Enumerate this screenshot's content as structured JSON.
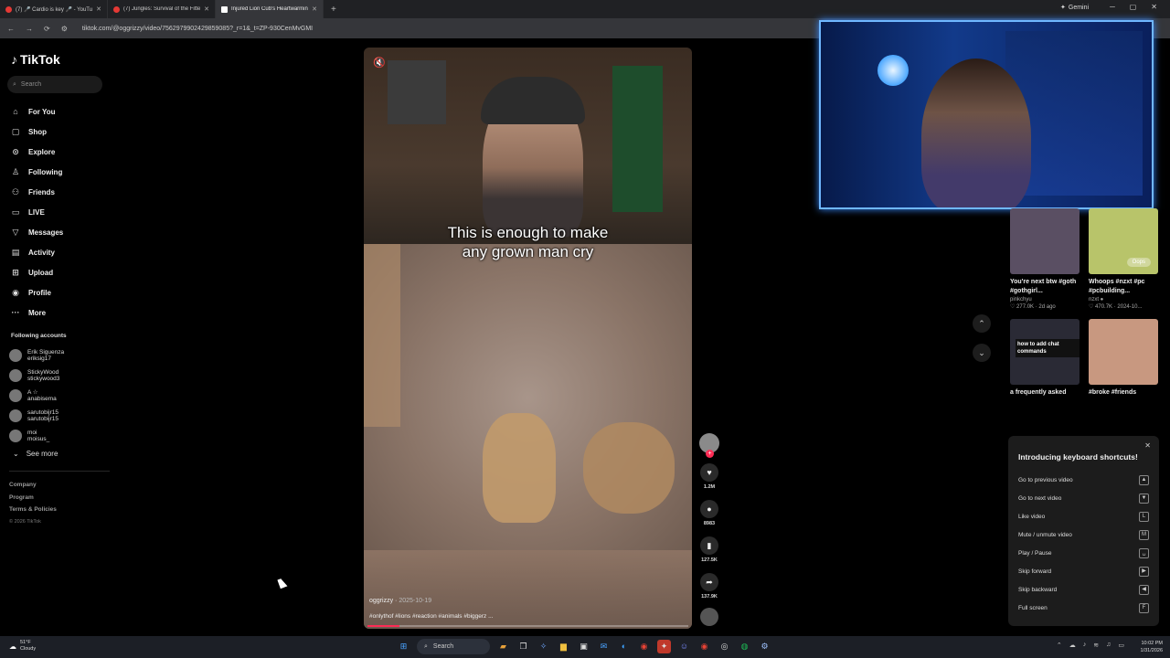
{
  "browser": {
    "tabs": [
      {
        "label": "(7) 🎤 Cardio is key 🎤 - YouTube",
        "active": false
      },
      {
        "label": "(7) Jungles: Survival of the Fittest",
        "active": false
      },
      {
        "label": "Injured Lion Cub's Heartwarming",
        "active": true
      }
    ],
    "new_tab_icon": "+",
    "gemini_label": "Gemini",
    "url": "tiktok.com/@oggrizzy/video/7562979902429859085?_r=1&_t=ZP-930CenMvGMI"
  },
  "sidebar": {
    "logo": "TikTok",
    "search_placeholder": "Search",
    "nav": [
      {
        "label": "For You",
        "icon": "⌂"
      },
      {
        "label": "Shop",
        "icon": "▢"
      },
      {
        "label": "Explore",
        "icon": "⊙"
      },
      {
        "label": "Following",
        "icon": "♙"
      },
      {
        "label": "Friends",
        "icon": "⚇"
      },
      {
        "label": "LIVE",
        "icon": "▭"
      },
      {
        "label": "Messages",
        "icon": "▽"
      },
      {
        "label": "Activity",
        "icon": "▤"
      },
      {
        "label": "Upload",
        "icon": "⊞"
      },
      {
        "label": "Profile",
        "icon": "◉"
      },
      {
        "label": "More",
        "icon": "···"
      }
    ],
    "following_heading": "Following accounts",
    "accounts": [
      {
        "name": "Erik Siguenza",
        "handle": "eriksig17"
      },
      {
        "name": "StickyWood",
        "handle": "stickywood3"
      },
      {
        "name": "A ☆",
        "handle": "anabisema"
      },
      {
        "name": "sarutobijr15",
        "handle": "sarutobijr15"
      },
      {
        "name": "moi",
        "handle": "moisus_"
      }
    ],
    "see_more": "See more",
    "footer": [
      "Company",
      "Program",
      "Terms & Policies"
    ],
    "copyright": "© 2026 TikTok"
  },
  "video": {
    "caption_line1": "This is enough to make",
    "caption_line2": "any grown man cry",
    "author": "oggrizzy",
    "date": "2025-10-19",
    "hashtags": "#onlythof #lions #reaction #animals #biggerz ...",
    "progress": 0.1,
    "mute_icon": "🔇"
  },
  "actions": {
    "likes": "1.2M",
    "comments": "8983",
    "saves": "127.5K",
    "shares": "137.9K"
  },
  "thumbnails": [
    {
      "title": "You're next btw #goth #gothgirl...",
      "author": "pinkchyu",
      "meta": "♡ 277.0K · 2d ago",
      "color": "#5a4f63"
    },
    {
      "title": "Whoops #nzxt #pc #pcbuilding...",
      "author": "nzxt ●",
      "meta": "♡ 470.7K · 2024-10...",
      "color": "#b8c46a",
      "button": "Oops"
    },
    {
      "title": "a frequently asked",
      "author": "",
      "meta": "",
      "color": "#2a2a35",
      "overlay": "how to add chat commands"
    },
    {
      "title": "#broke #friends",
      "author": "",
      "meta": "",
      "color": "#c89880"
    }
  ],
  "shortcuts": {
    "title": "Introducing keyboard shortcuts!",
    "items": [
      {
        "label": "Go to previous video",
        "key": "▲"
      },
      {
        "label": "Go to next video",
        "key": "▼"
      },
      {
        "label": "Like video",
        "key": "L"
      },
      {
        "label": "Mute / unmute video",
        "key": "M"
      },
      {
        "label": "Play / Pause",
        "key": "␣"
      },
      {
        "label": "Skip forward",
        "key": "▶"
      },
      {
        "label": "Skip backward",
        "key": "◀"
      },
      {
        "label": "Full screen",
        "key": "F"
      }
    ]
  },
  "taskbar": {
    "weather_temp": "51°F",
    "weather_desc": "Cloudy",
    "search_label": "Search",
    "time": "10:02 PM",
    "date": "1/31/2026"
  },
  "colors": {
    "accent": "#fe2c55",
    "webcam_border": "#6fb7ff"
  }
}
